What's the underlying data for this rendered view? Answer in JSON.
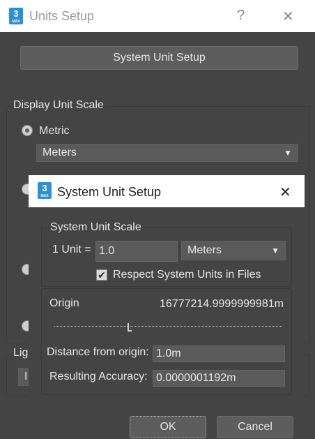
{
  "main_window": {
    "title": "Units Setup",
    "help_label": "?",
    "close_label": "✕",
    "app_icon": {
      "big": "3",
      "small": "MAX"
    },
    "system_unit_setup_button": "System Unit Setup",
    "display_unit_scale": {
      "title": "Display Unit Scale",
      "metric_label": "Metric",
      "metric_value": "Meters",
      "lighting_partial": "Ligh",
      "partial_field": "I"
    }
  },
  "dialog": {
    "title": "System Unit Setup",
    "close_label": "✕",
    "app_icon": {
      "big": "3",
      "small": "MAX"
    },
    "system_unit_scale": {
      "title": "System Unit Scale",
      "unit_label": "1 Unit =",
      "unit_value": "1.0",
      "unit_type": "Meters"
    },
    "respect_label": "Respect System Units in Files",
    "respect_checked": true,
    "origin": {
      "label": "Origin",
      "value": "16777214.9999999981m",
      "slider_position": 0.33
    },
    "distance_label": "Distance from origin:",
    "distance_value": "1.0m",
    "accuracy_label": "Resulting Accuracy:",
    "accuracy_value": "0.0000001192m",
    "ok_label": "OK",
    "cancel_label": "Cancel"
  },
  "colors": {
    "background": "#444444",
    "titlebar": "#ffffff",
    "app_icon": "#2d8fd6",
    "button": "#5d5d5d"
  }
}
